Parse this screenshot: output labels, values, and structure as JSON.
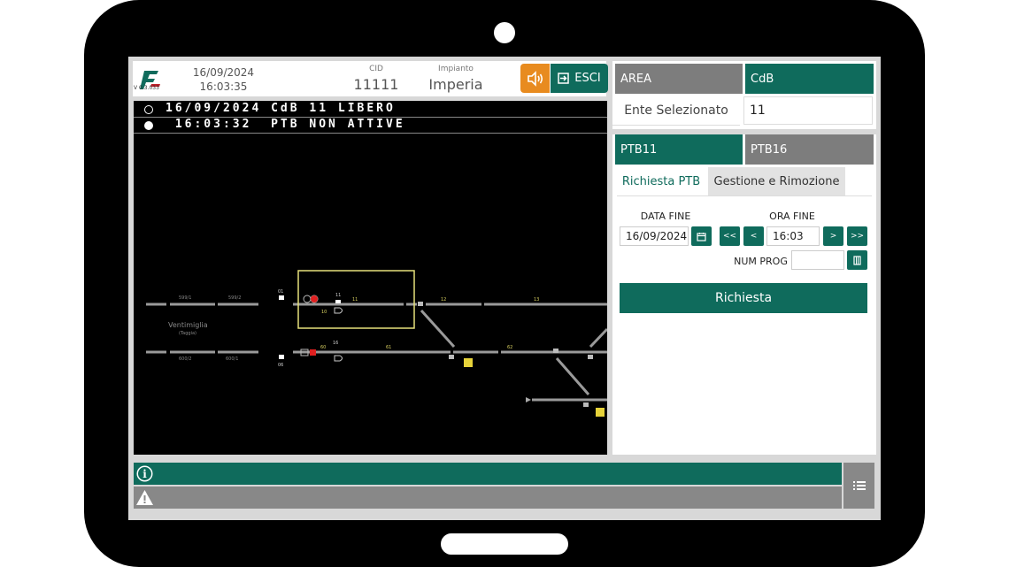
{
  "header": {
    "version": "V 0.3.033",
    "date": "16/09/2024",
    "time": "16:03:35",
    "cid_label": "CID",
    "cid_value": "11111",
    "impianto_label": "Impianto",
    "impianto_value": "Imperia",
    "exit_label": "ESCI",
    "sound_icon": "speaker-icon",
    "exit_icon": "exit-icon"
  },
  "messages": [
    {
      "text": "16/09/2024 CdB 11 LIBERO",
      "filled": false
    },
    {
      "text": " 16:03:32  PTB NON ATTIVE",
      "filled": true
    }
  ],
  "schematic": {
    "station_name": "Ventimiglia",
    "station_sub": "(Taggia)",
    "labels": [
      "599/1",
      "599/2",
      "600/2",
      "600/1",
      "01",
      "06",
      "11",
      "10",
      "11",
      "12",
      "13",
      "60",
      "16",
      "61",
      "62"
    ],
    "colors": {
      "track": "#9a9a9a",
      "highlight": "#e6e07a",
      "signal_red": "#e02020",
      "label": "#d8d060"
    }
  },
  "right_panel": {
    "area_label": "AREA",
    "cdb_label": "CdB",
    "ente_label": "Ente Selezionato",
    "ente_value": "11",
    "ptb11_label": "PTB11",
    "ptb16_label": "PTB16",
    "tab_richiesta": "Richiesta PTB",
    "tab_gestione": "Gestione e Rimozione",
    "data_fine_label": "DATA FINE",
    "data_fine_value": "16/09/2024",
    "ora_fine_label": "ORA FINE",
    "ora_fine_value": "16:03",
    "num_prog_label": "NUM PROG",
    "num_prog_value": "",
    "btn_back_fast": "<<",
    "btn_back": "<",
    "btn_fwd": ">",
    "btn_fwd_fast": ">>",
    "richiesta_label": "Richiesta"
  },
  "colors": {
    "accent": "#0f6b5c",
    "warning": "#e88b1f",
    "gray": "#7d7d7d"
  }
}
